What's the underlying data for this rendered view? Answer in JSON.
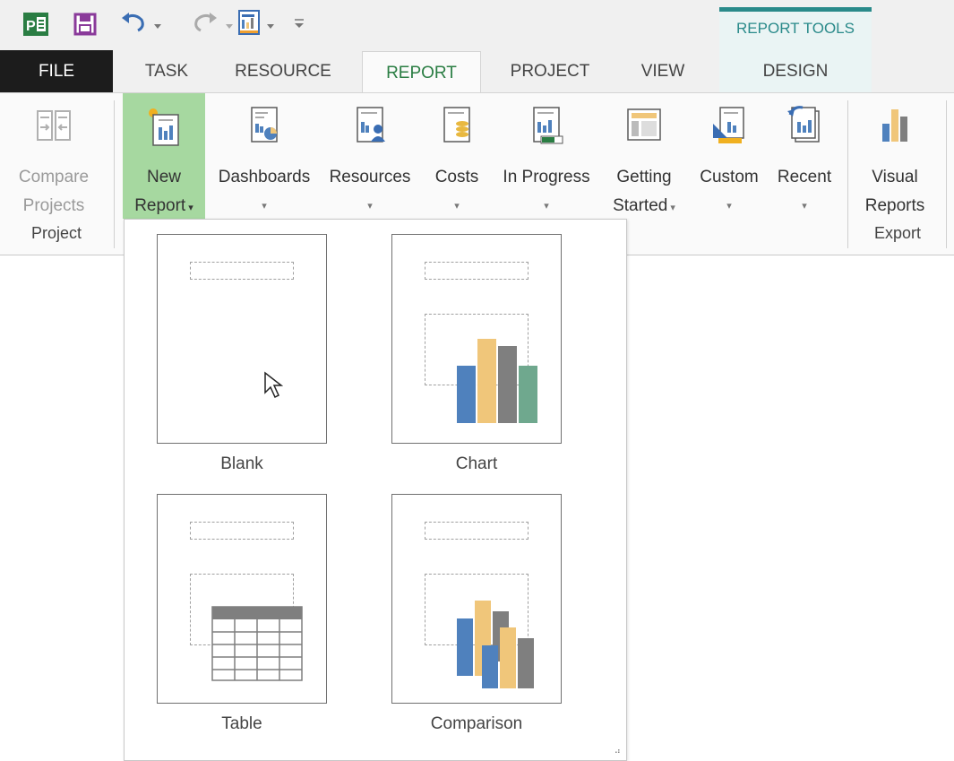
{
  "contextual": {
    "label": "REPORT TOOLS"
  },
  "tabs": [
    {
      "label": "FILE"
    },
    {
      "label": "TASK"
    },
    {
      "label": "RESOURCE"
    },
    {
      "label": "REPORT"
    },
    {
      "label": "PROJECT"
    },
    {
      "label": "VIEW"
    },
    {
      "label": "DESIGN"
    }
  ],
  "ribbon": {
    "compare": {
      "line1": "Compare",
      "line2": "Projects"
    },
    "new_report": {
      "line1": "New",
      "line2": "Report"
    },
    "dashboards": {
      "line1": "Dashboards"
    },
    "resources": {
      "line1": "Resources"
    },
    "costs": {
      "line1": "Costs"
    },
    "in_progress": {
      "line1": "In Progress"
    },
    "getting_started": {
      "line1": "Getting",
      "line2": "Started"
    },
    "custom": {
      "line1": "Custom"
    },
    "recent": {
      "line1": "Recent"
    },
    "visual_reports": {
      "line1": "Visual",
      "line2": "Reports"
    },
    "groups": {
      "project": "Project",
      "export": "Export"
    }
  },
  "dropdown": {
    "items": [
      {
        "label": "Blank"
      },
      {
        "label": "Chart"
      },
      {
        "label": "Table"
      },
      {
        "label": "Comparison"
      }
    ]
  },
  "colors": {
    "accent_green": "#2a7d43",
    "contextual_teal": "#2a8a8a",
    "bar_blue": "#4f81bd",
    "bar_tan": "#f0c67a",
    "bar_gray": "#7f7f7f",
    "bar_green": "#6fa88e"
  }
}
